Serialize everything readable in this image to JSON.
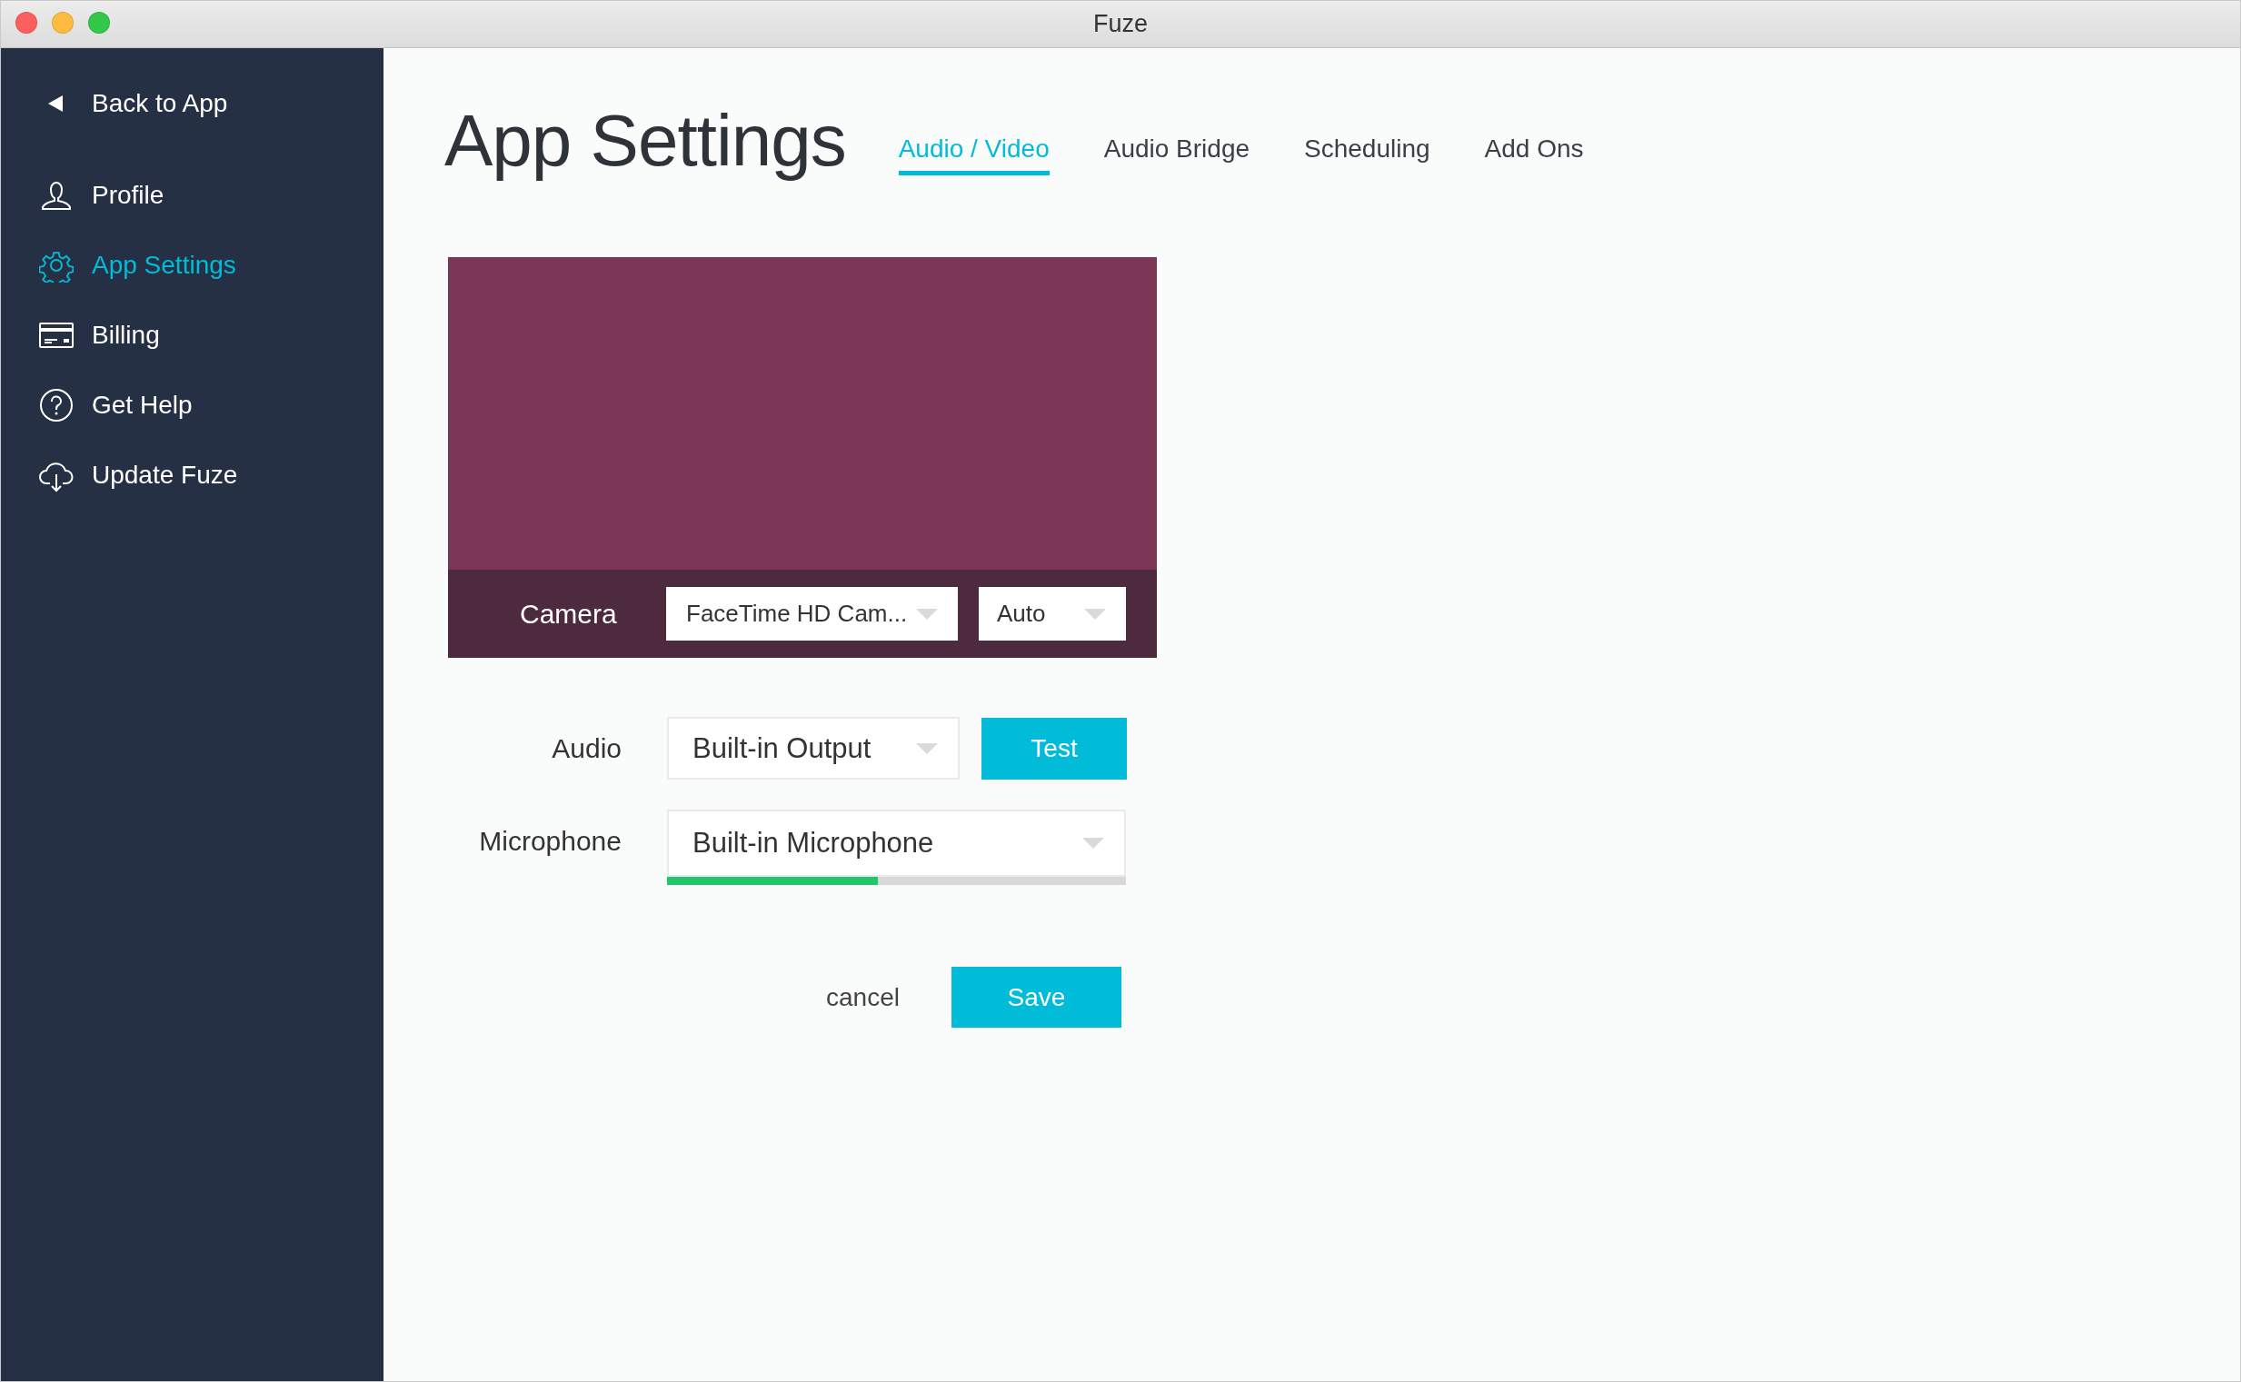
{
  "window": {
    "title": "Fuze"
  },
  "sidebar": {
    "back": {
      "label": "Back to App"
    },
    "items": [
      {
        "kind": "profile",
        "label": "Profile",
        "selected": false
      },
      {
        "kind": "settings",
        "label": "App Settings",
        "selected": true
      },
      {
        "kind": "billing",
        "label": "Billing",
        "selected": false
      },
      {
        "kind": "help",
        "label": "Get Help",
        "selected": false
      },
      {
        "kind": "update",
        "label": "Update Fuze",
        "selected": false
      }
    ]
  },
  "page": {
    "title": "App Settings"
  },
  "tabs": [
    {
      "label": "Audio / Video",
      "selected": true
    },
    {
      "label": "Audio Bridge",
      "selected": false
    },
    {
      "label": "Scheduling",
      "selected": false
    },
    {
      "label": "Add Ons",
      "selected": false
    }
  ],
  "camera": {
    "label": "Camera",
    "device": "FaceTime HD Cam...",
    "resolution": "Auto"
  },
  "audio": {
    "label": "Audio",
    "device": "Built-in Output",
    "test": "Test"
  },
  "microphone": {
    "label": "Microphone",
    "device": "Built-in Microphone",
    "level": 0.46
  },
  "actions": {
    "cancel": "cancel",
    "save": "Save"
  }
}
